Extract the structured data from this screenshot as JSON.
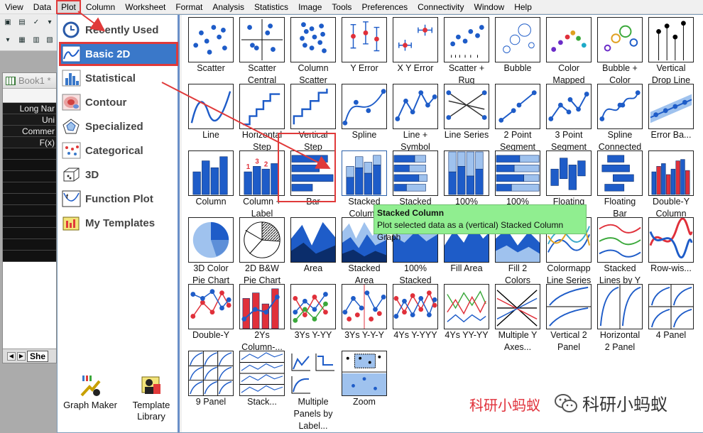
{
  "menubar": [
    "View",
    "Data",
    "Plot",
    "Column",
    "Worksheet",
    "Format",
    "Analysis",
    "Statistics",
    "Image",
    "Tools",
    "Preferences",
    "Connectivity",
    "Window",
    "Help"
  ],
  "book": {
    "title": "Book1 *",
    "rows": [
      "Long Nar",
      "Uni",
      "Commer",
      "F(x)",
      ""
    ],
    "sheet": "She"
  },
  "categories": [
    {
      "label": "Recently Used",
      "icon": "recent-clock-icon"
    },
    {
      "label": "Basic 2D",
      "icon": "line-graph-icon"
    },
    {
      "label": "Statistical",
      "icon": "histogram-icon"
    },
    {
      "label": "Contour",
      "icon": "contour-icon"
    },
    {
      "label": "Specialized",
      "icon": "polar-pentagon-icon"
    },
    {
      "label": "Categorical",
      "icon": "categorical-dots-icon"
    },
    {
      "label": "3D",
      "icon": "cube-3d-icon"
    },
    {
      "label": "Function Plot",
      "icon": "function-plot-icon"
    },
    {
      "label": "My Templates",
      "icon": "templates-icon"
    }
  ],
  "bottom_tools": [
    {
      "label": "Graph Maker",
      "icon": "graph-maker-icon"
    },
    {
      "label": "Template\nLibrary",
      "icon": "template-library-icon"
    }
  ],
  "gallery": [
    [
      "Scatter",
      "Scatter\nCentral",
      "Column\nScatter",
      "Y Error",
      "X Y Error",
      "Scatter +\nRug",
      "Bubble",
      "Color\nMapped",
      "Bubble +\nColor",
      "Vertical\nDrop Line"
    ],
    [
      "Line",
      "Horizontal\nStep",
      "Vertical\nStep",
      "Spline",
      "Line +\nSymbol",
      "Line Series",
      "2 Point\nSegment",
      "3 Point\nSegment",
      "Spline\nConnected",
      "Error Ba..."
    ],
    [
      "Column",
      "Column +\nLabel",
      "Bar",
      "Stacked\nColumn",
      "Stacked",
      "100%\nStacked",
      "100%\nStacked",
      "Floating\nColumn",
      "Floating\nBar",
      "Double-Y\nColumn"
    ],
    [
      "3D Color\nPie Chart",
      "2D B&W\nPie Chart",
      "Area",
      "Stacked\nArea",
      "100%\nStacked",
      "Fill Area",
      "Fill 2\nColors",
      "Colormapp\nLine Series",
      "Stacked\nLines by Y",
      "Row-wis..."
    ],
    [
      "Double-Y",
      "2Ys\nColumn-...",
      "3Ys Y-YY",
      "3Ys Y-Y-Y",
      "4Ys Y-YYY",
      "4Ys YY-YY",
      "Multiple Y\nAxes...",
      "Vertical 2\nPanel",
      "Horizontal\n2 Panel",
      "4 Panel"
    ],
    [
      "9 Panel",
      "Stack...",
      "Multiple\nPanels by\nLabel...",
      "Zoom"
    ]
  ],
  "tooltip": {
    "title": "Stacked Column",
    "text": "Plot selected data as a (vertical) Stacked Column Graph"
  },
  "watermark": "科研小蚂蚁",
  "wechat": "科研小蚂蚁",
  "colors": {
    "accent": "#3a78c9",
    "highlight": "#e03a3a",
    "tooltip": "#90ee90"
  }
}
